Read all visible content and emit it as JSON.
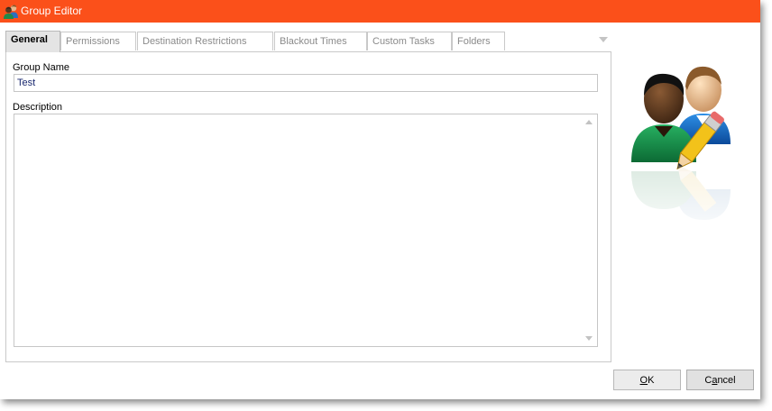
{
  "window": {
    "title": "Group Editor",
    "title_icon": "group-users-icon",
    "titlebar_color": "#fb501a"
  },
  "tabs": [
    {
      "label": "General",
      "active": true
    },
    {
      "label": "Permissions",
      "active": false
    },
    {
      "label": "Destination Restrictions",
      "active": false
    },
    {
      "label": "Blackout Times",
      "active": false
    },
    {
      "label": "Custom Tasks",
      "active": false
    },
    {
      "label": "Folders",
      "active": false
    }
  ],
  "form": {
    "group_name_label": "Group Name",
    "group_name_value": "Test",
    "description_label": "Description",
    "description_value": ""
  },
  "buttons": {
    "ok": {
      "accel": "O",
      "rest": "K"
    },
    "cancel": {
      "pre": "C",
      "accel": "a",
      "rest": "ncel"
    }
  },
  "illustration": {
    "icon": "group-users-edit-icon"
  }
}
